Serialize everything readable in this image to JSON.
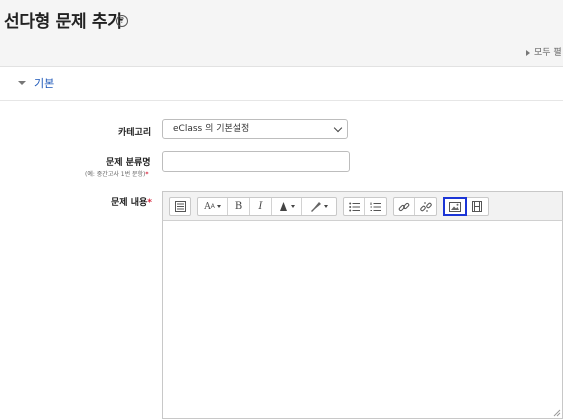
{
  "page": {
    "title": "선다형 문제 추가",
    "help_icon": "?",
    "expand_all": "모두 펼"
  },
  "section": {
    "title": "기본"
  },
  "fields": {
    "category": {
      "label": "카테고리",
      "value": "eClass 의 기본설정"
    },
    "name": {
      "label": "문제 분류명",
      "hint": "(예: 중간고사 1번 문항)",
      "required_mark": "*",
      "value": ""
    },
    "question_text": {
      "label": "문제 내용",
      "required_mark": "*"
    }
  },
  "toolbar": {
    "groups": [
      [
        "toolbar-toggle-icon"
      ],
      [
        "font-size-icon",
        "bold-icon",
        "italic-icon",
        "font-color-icon",
        "highlight-color-icon"
      ],
      [
        "unordered-list-icon",
        "ordered-list-icon"
      ],
      [
        "link-icon",
        "unlink-icon"
      ],
      [
        "insert-image-icon",
        "insert-media-icon"
      ]
    ],
    "highlighted": "insert-image-icon",
    "labels": {
      "bold": "B",
      "italic": "I"
    }
  },
  "colors": {
    "accent": "#1b56b8",
    "highlight": "#1b35d6",
    "required": "#d7263d"
  }
}
